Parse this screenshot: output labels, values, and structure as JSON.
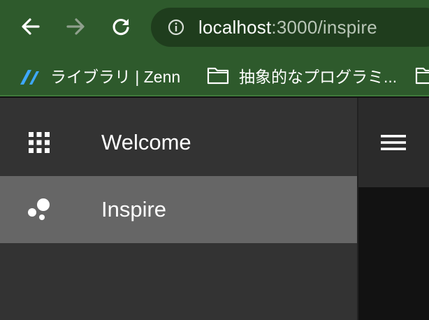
{
  "browser": {
    "back_icon": "arrow-left-icon",
    "forward_icon": "arrow-right-icon",
    "reload_icon": "reload-icon",
    "site_info_icon": "info-circle-icon",
    "url_host": "localhost",
    "url_rest": ":3000/inspire"
  },
  "bookmarks": [
    {
      "icon": "zenn-logo-icon",
      "label": "ライブラリ | Zenn"
    },
    {
      "icon": "folder-icon",
      "label": "抽象的なプログラミ..."
    },
    {
      "icon": "folder-icon",
      "label": ""
    }
  ],
  "drawer": {
    "items": [
      {
        "icon": "apps-grid-icon",
        "label": "Welcome",
        "active": false
      },
      {
        "icon": "bubbles-icon",
        "label": "Inspire",
        "active": true
      }
    ]
  },
  "appbar": {
    "menu_icon": "hamburger-menu-icon"
  },
  "colors": {
    "toolbar": "#2e5a2c",
    "omnibox": "#1f3d1d",
    "drawer": "#333333",
    "drawer_active": "#666666",
    "appbar": "#2b2b2b",
    "content": "#121212"
  }
}
